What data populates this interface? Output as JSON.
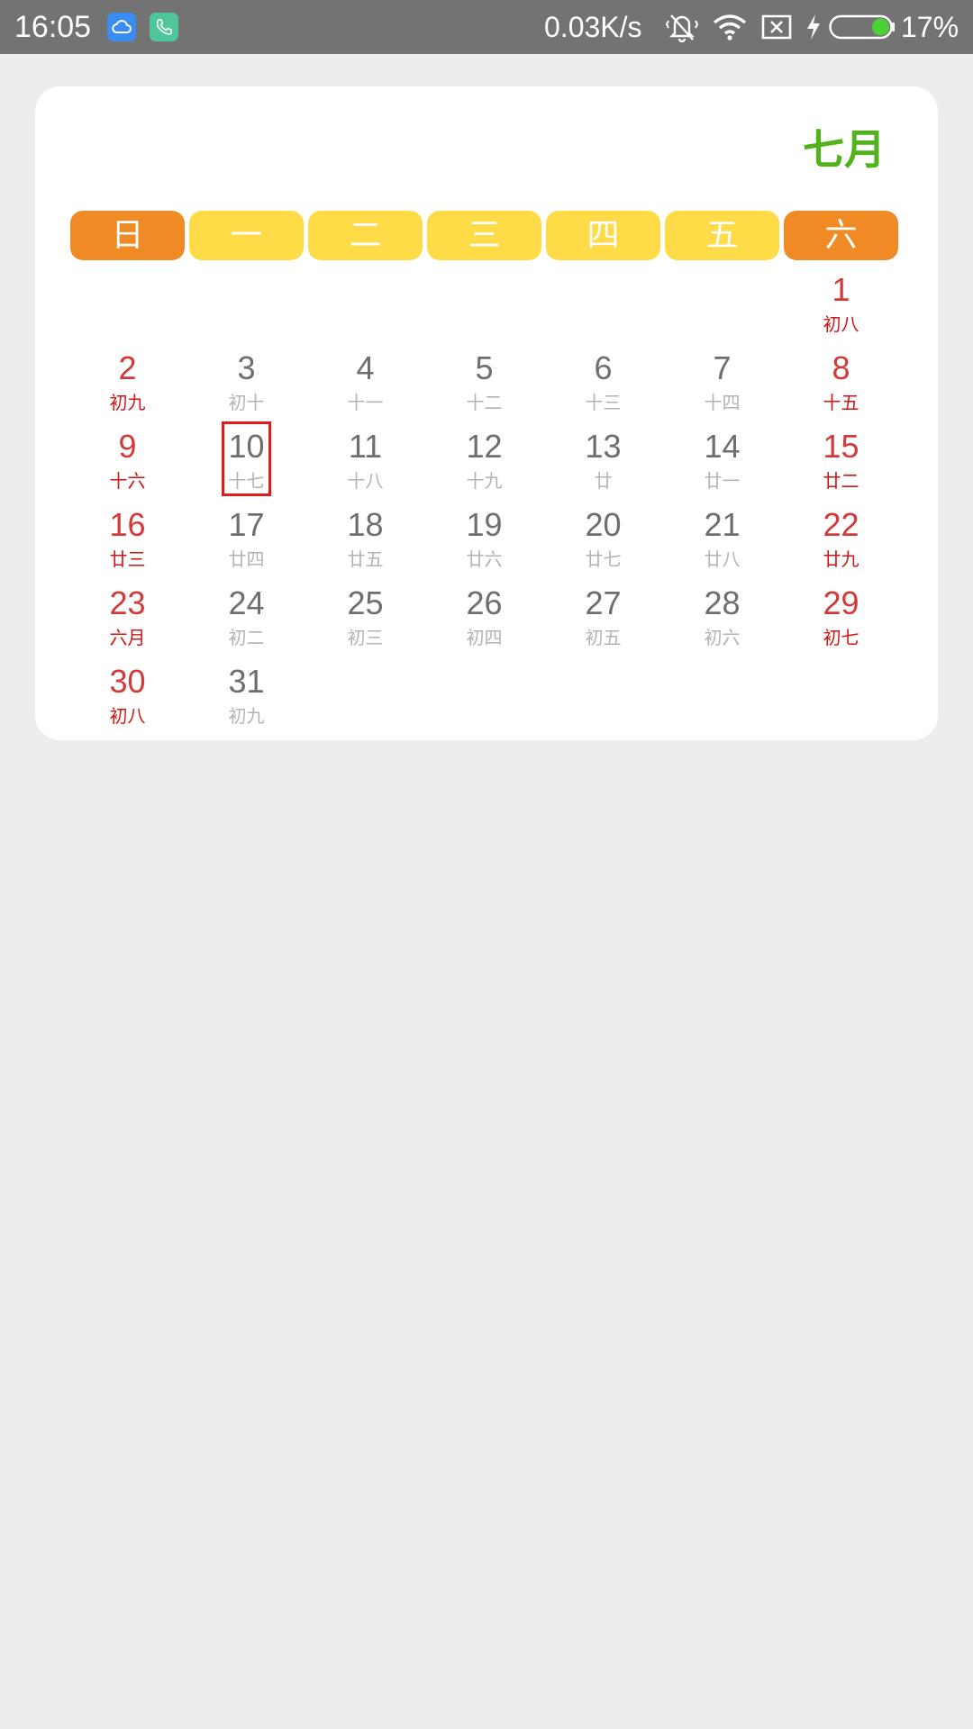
{
  "status_bar": {
    "time": "16:05",
    "net_speed": "0.03K/s",
    "battery_percent": "17%",
    "battery_level": 0.17,
    "icons": [
      "cloud-app-icon",
      "phone-app-icon",
      "vibrate-mute-icon",
      "wifi-icon",
      "no-sim-icon",
      "charging-bolt-icon",
      "battery-icon"
    ]
  },
  "calendar": {
    "month_title": "七月",
    "weekdays": [
      {
        "label": "日",
        "weekend": true
      },
      {
        "label": "一",
        "weekend": false
      },
      {
        "label": "二",
        "weekend": false
      },
      {
        "label": "三",
        "weekend": false
      },
      {
        "label": "四",
        "weekend": false
      },
      {
        "label": "五",
        "weekend": false
      },
      {
        "label": "六",
        "weekend": true
      }
    ],
    "first_weekday_index": 6,
    "selected_day": "10",
    "days": [
      {
        "day": "1",
        "lunar": "初八"
      },
      {
        "day": "2",
        "lunar": "初九"
      },
      {
        "day": "3",
        "lunar": "初十"
      },
      {
        "day": "4",
        "lunar": "十一"
      },
      {
        "day": "5",
        "lunar": "十二"
      },
      {
        "day": "6",
        "lunar": "十三"
      },
      {
        "day": "7",
        "lunar": "十四"
      },
      {
        "day": "8",
        "lunar": "十五"
      },
      {
        "day": "9",
        "lunar": "十六"
      },
      {
        "day": "10",
        "lunar": "十七"
      },
      {
        "day": "11",
        "lunar": "十八"
      },
      {
        "day": "12",
        "lunar": "十九"
      },
      {
        "day": "13",
        "lunar": "廿"
      },
      {
        "day": "14",
        "lunar": "廿一"
      },
      {
        "day": "15",
        "lunar": "廿二"
      },
      {
        "day": "16",
        "lunar": "廿三"
      },
      {
        "day": "17",
        "lunar": "廿四"
      },
      {
        "day": "18",
        "lunar": "廿五"
      },
      {
        "day": "19",
        "lunar": "廿六"
      },
      {
        "day": "20",
        "lunar": "廿七"
      },
      {
        "day": "21",
        "lunar": "廿八"
      },
      {
        "day": "22",
        "lunar": "廿九"
      },
      {
        "day": "23",
        "lunar": "六月"
      },
      {
        "day": "24",
        "lunar": "初二"
      },
      {
        "day": "25",
        "lunar": "初三"
      },
      {
        "day": "26",
        "lunar": "初四"
      },
      {
        "day": "27",
        "lunar": "初五"
      },
      {
        "day": "28",
        "lunar": "初六"
      },
      {
        "day": "29",
        "lunar": "初七"
      },
      {
        "day": "30",
        "lunar": "初八"
      },
      {
        "day": "31",
        "lunar": "初九"
      }
    ]
  },
  "colors": {
    "status_bar_bg": "#737373",
    "page_bg": "#ededed",
    "month_title": "#52b21e",
    "weekend_header": "#f08a24",
    "workday_header": "#ffdb47",
    "weekend_text": "#d23a3a",
    "workday_text": "#6e6e6e",
    "lunar_workday": "#b3b3b3",
    "today_border": "#e21a1a"
  }
}
